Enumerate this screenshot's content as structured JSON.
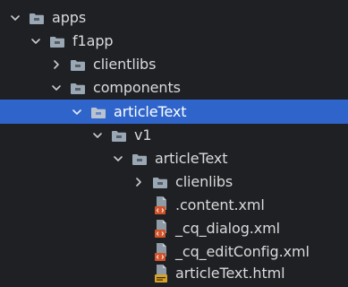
{
  "tree": {
    "items": [
      {
        "label": "apps",
        "kind": "folder",
        "state": "expanded",
        "icon": "folder-icon"
      },
      {
        "label": "f1app",
        "kind": "folder",
        "state": "expanded",
        "icon": "folder-icon"
      },
      {
        "label": "clientlibs",
        "kind": "folder",
        "state": "collapsed",
        "icon": "folder-icon"
      },
      {
        "label": "components",
        "kind": "folder",
        "state": "expanded",
        "icon": "folder-icon"
      },
      {
        "label": "articleText",
        "kind": "folder",
        "state": "expanded",
        "selected": true,
        "icon": "folder-icon"
      },
      {
        "label": "v1",
        "kind": "folder",
        "state": "expanded",
        "icon": "folder-icon"
      },
      {
        "label": "articleText",
        "kind": "folder",
        "state": "expanded",
        "icon": "folder-icon"
      },
      {
        "label": "clienlibs",
        "kind": "folder",
        "state": "collapsed",
        "icon": "folder-icon"
      },
      {
        "label": ".content.xml",
        "kind": "file",
        "icon": "xml-file-icon"
      },
      {
        "label": "_cq_dialog.xml",
        "kind": "file",
        "icon": "xml-file-icon"
      },
      {
        "label": "_cq_editConfig.xml",
        "kind": "file",
        "icon": "xml-file-icon"
      },
      {
        "label": "articleText.html",
        "kind": "file",
        "icon": "html-file-icon"
      }
    ]
  },
  "colors": {
    "background": "#1f2023",
    "selection": "#2f65ca",
    "text": "#d9dadc",
    "folder": "#9aa7b4",
    "xml_badge": "#d0542b",
    "html_badge": "#d7a12a"
  }
}
